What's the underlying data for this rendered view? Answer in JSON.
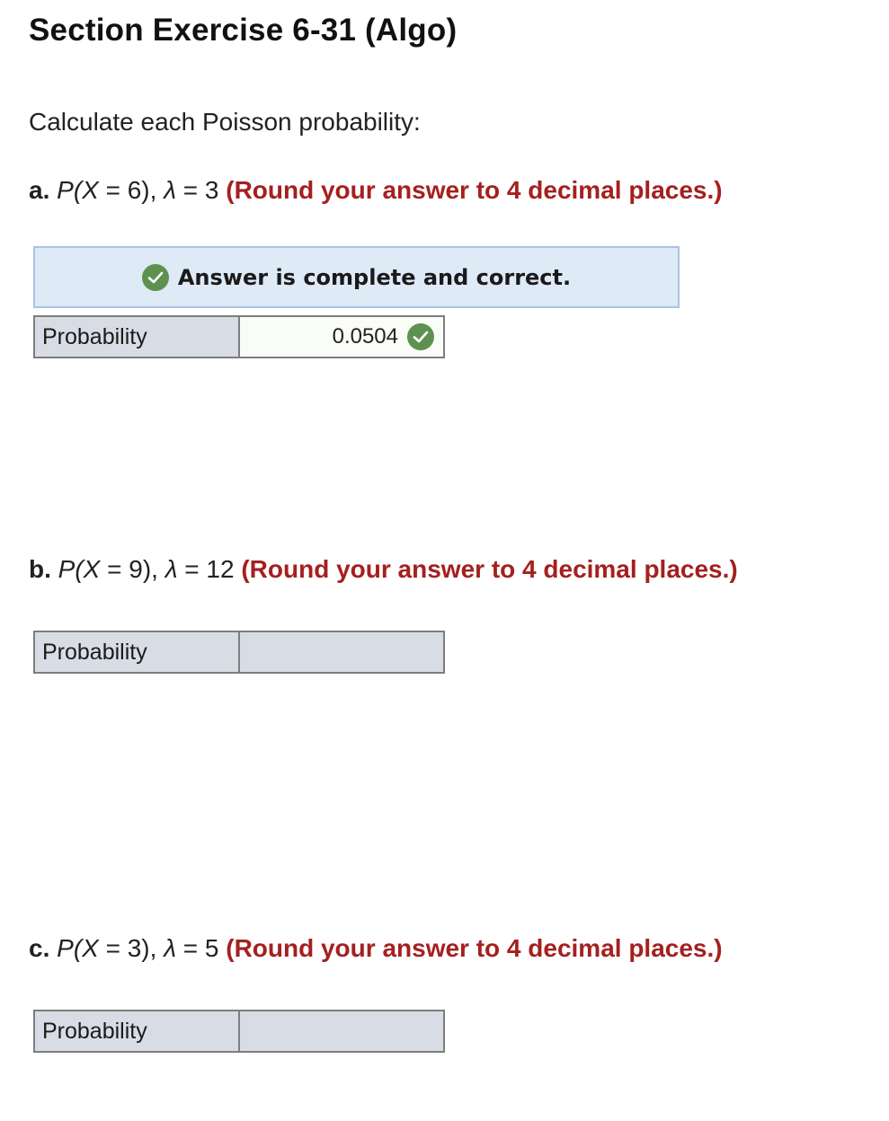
{
  "title": "Section Exercise 6-31 (Algo)",
  "intro": "Calculate each Poisson probability:",
  "parts": [
    {
      "letter": "a.",
      "p_open": "P(",
      "var": "X",
      "equals_value": " = 6), ",
      "lambda": "λ",
      "lambda_value": " = 3 ",
      "instruction": "(Round your answer to 4 decimal places.)",
      "row_label": "Probability",
      "answer_value": "0.0504",
      "status": "correct"
    },
    {
      "letter": "b.",
      "p_open": "P(",
      "var": "X",
      "equals_value": " = 9), ",
      "lambda": "λ",
      "lambda_value": " = 12 ",
      "instruction": "(Round your answer to 4 decimal places.)",
      "row_label": "Probability",
      "answer_value": ""
    },
    {
      "letter": "c.",
      "p_open": "P(",
      "var": "X",
      "equals_value": " = 3), ",
      "lambda": "λ",
      "lambda_value": " = 5 ",
      "instruction": "(Round your answer to 4 decimal places.)",
      "row_label": "Probability",
      "answer_value": ""
    }
  ],
  "status_banner": {
    "text": "Answer is complete and correct.",
    "icon": "check-circle-icon"
  },
  "colors": {
    "instruction_red": "#a4201f",
    "banner_bg": "#dfeaf7",
    "banner_border": "#a9c4e4",
    "check_green": "#5e9150",
    "label_bg": "#d8dde5"
  }
}
